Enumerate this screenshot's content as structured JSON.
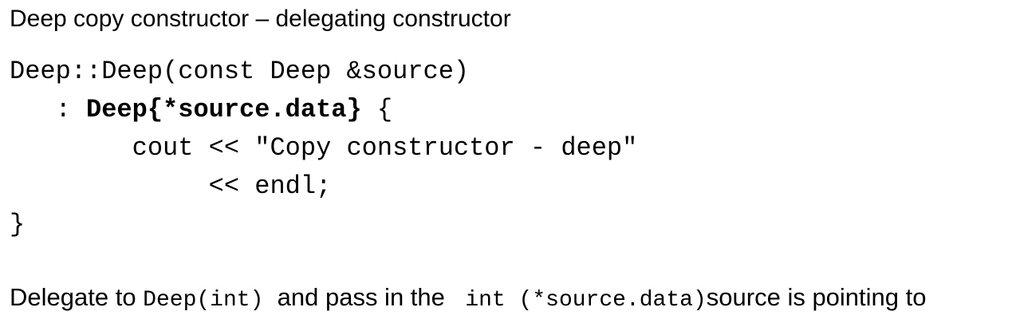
{
  "title": "Deep copy constructor – delegating constructor",
  "code": {
    "line1": "Deep::Deep(const Deep &source)",
    "line2_indent": "   : ",
    "line2_bold": "Deep{*source.data}",
    "line2_rest": " {",
    "line3": "        cout << \"Copy constructor - deep\"",
    "line4": "             << endl;",
    "line5": "}"
  },
  "caption": {
    "text1": "Delegate to ",
    "code1": "Deep(int)",
    "text2": "  and pass in the ",
    "code2": " int (*source.data)",
    "text3": "source is pointing to"
  }
}
